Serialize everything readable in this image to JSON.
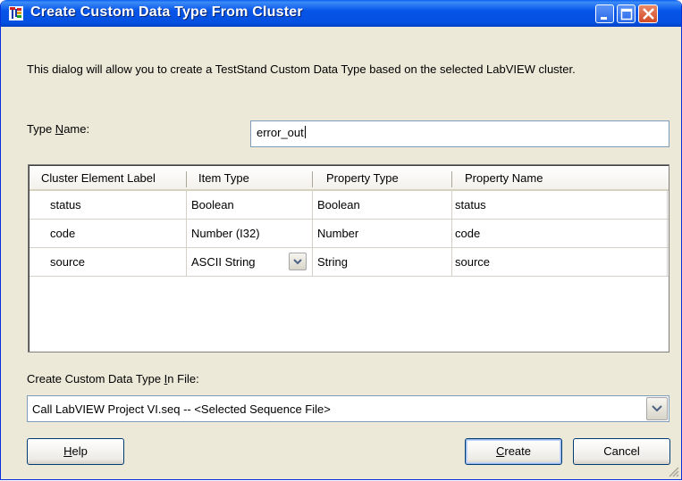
{
  "window": {
    "title": "Create Custom Data Type From Cluster",
    "app_icon": "teststand-type-icon",
    "controls": [
      "minimize",
      "maximize",
      "close"
    ]
  },
  "description": "This dialog will allow you to create a TestStand Custom Data Type based on the selected LabVIEW cluster.",
  "type_name": {
    "label_pre": "Type ",
    "label_mnemonic": "N",
    "label_post": "ame:",
    "value": "error_out"
  },
  "grid": {
    "columns": [
      "Cluster Element Label",
      "Item Type",
      "Property Type",
      "Property Name"
    ],
    "rows": [
      {
        "label": "status",
        "item_type": "Boolean",
        "property_type": "Boolean",
        "property_name": "status"
      },
      {
        "label": "code",
        "item_type": "Number (I32)",
        "property_type": "Number",
        "property_name": "code"
      },
      {
        "label": "source",
        "item_type": "ASCII String",
        "property_type": "String",
        "property_name": "source"
      }
    ]
  },
  "file": {
    "label_pre": "Create Custom Data Type ",
    "label_mnemonic": "I",
    "label_post": "n File:",
    "selected": "Call LabVIEW Project VI.seq  -- <Selected Sequence File>"
  },
  "buttons": {
    "help_mnemonic": "H",
    "help_rest": "elp",
    "create_mnemonic": "C",
    "create_rest": "reate",
    "cancel": "Cancel"
  },
  "colors": {
    "titlebar": "#0755e8",
    "dialog_bg": "#ece9d8",
    "close_button": "#d24a24"
  }
}
